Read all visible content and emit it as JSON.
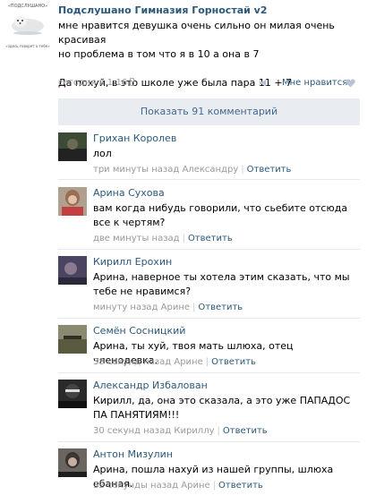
{
  "post": {
    "avatar_top_text": "«ПОДСЛУШАНО»",
    "avatar_bottom_text": "«здесь говорят о тебе»",
    "group_name": "Подслушано Гимназия Горностай v2",
    "text_lines": [
      "мне нравится девушка очень сильно он милая очень красивая",
      "но проблема в том что я в 10 а она в 7",
      "Да похуй, в это школе уже была пара 11 + 7"
    ],
    "time": "сегодня в 1:16",
    "like_label": "Мне нравится",
    "show_comments_label": "Показать 91 комментарий"
  },
  "comments": [
    {
      "author": "Грихан Королев",
      "text": "лол",
      "time": "три минуты назад",
      "reply_to": "Александру",
      "reply_label": "Ответить",
      "avatar_color": "#3d4a35"
    },
    {
      "author": "Арина Сухова",
      "text": "вам когда нибудь говорили, что сьебите отсюда все к чертям?",
      "time": "две минуты назад",
      "reply_to": "",
      "reply_label": "Ответить",
      "avatar_color": "#9a6e52"
    },
    {
      "author": "Кирилл Ерохин",
      "text": "Арина, наверное ты хотела этим сказать, что мы тебе не нравимся?",
      "time": "минуту назад",
      "reply_to": "Арине",
      "reply_label": "Ответить",
      "avatar_color": "#4a4460"
    },
    {
      "author": "Семён Сосницкий",
      "text": "Арина, ты хуй, твоя мать шлюха, отец членодевка.",
      "time": "38 секунд назад",
      "reply_to": "Арине",
      "reply_label": "Ответить",
      "avatar_color": "#5a5a40"
    },
    {
      "author": "Александр Избалован",
      "text": "Кирилл, да, она это сказала, а это уже ПАПАДОС ПА ПАНЯТИЯМ!!!",
      "time": "30 секунд назад",
      "reply_to": "Кириллу",
      "reply_label": "Ответить",
      "avatar_color": "#2a2a2a"
    },
    {
      "author": "Антон Мизулин",
      "text": "Арина, пошла нахуй из нашей группы, шлюха ебаная.",
      "time": "32 секунды назад",
      "reply_to": "Арине",
      "reply_label": "Ответить",
      "avatar_color": "#3a3530"
    }
  ]
}
